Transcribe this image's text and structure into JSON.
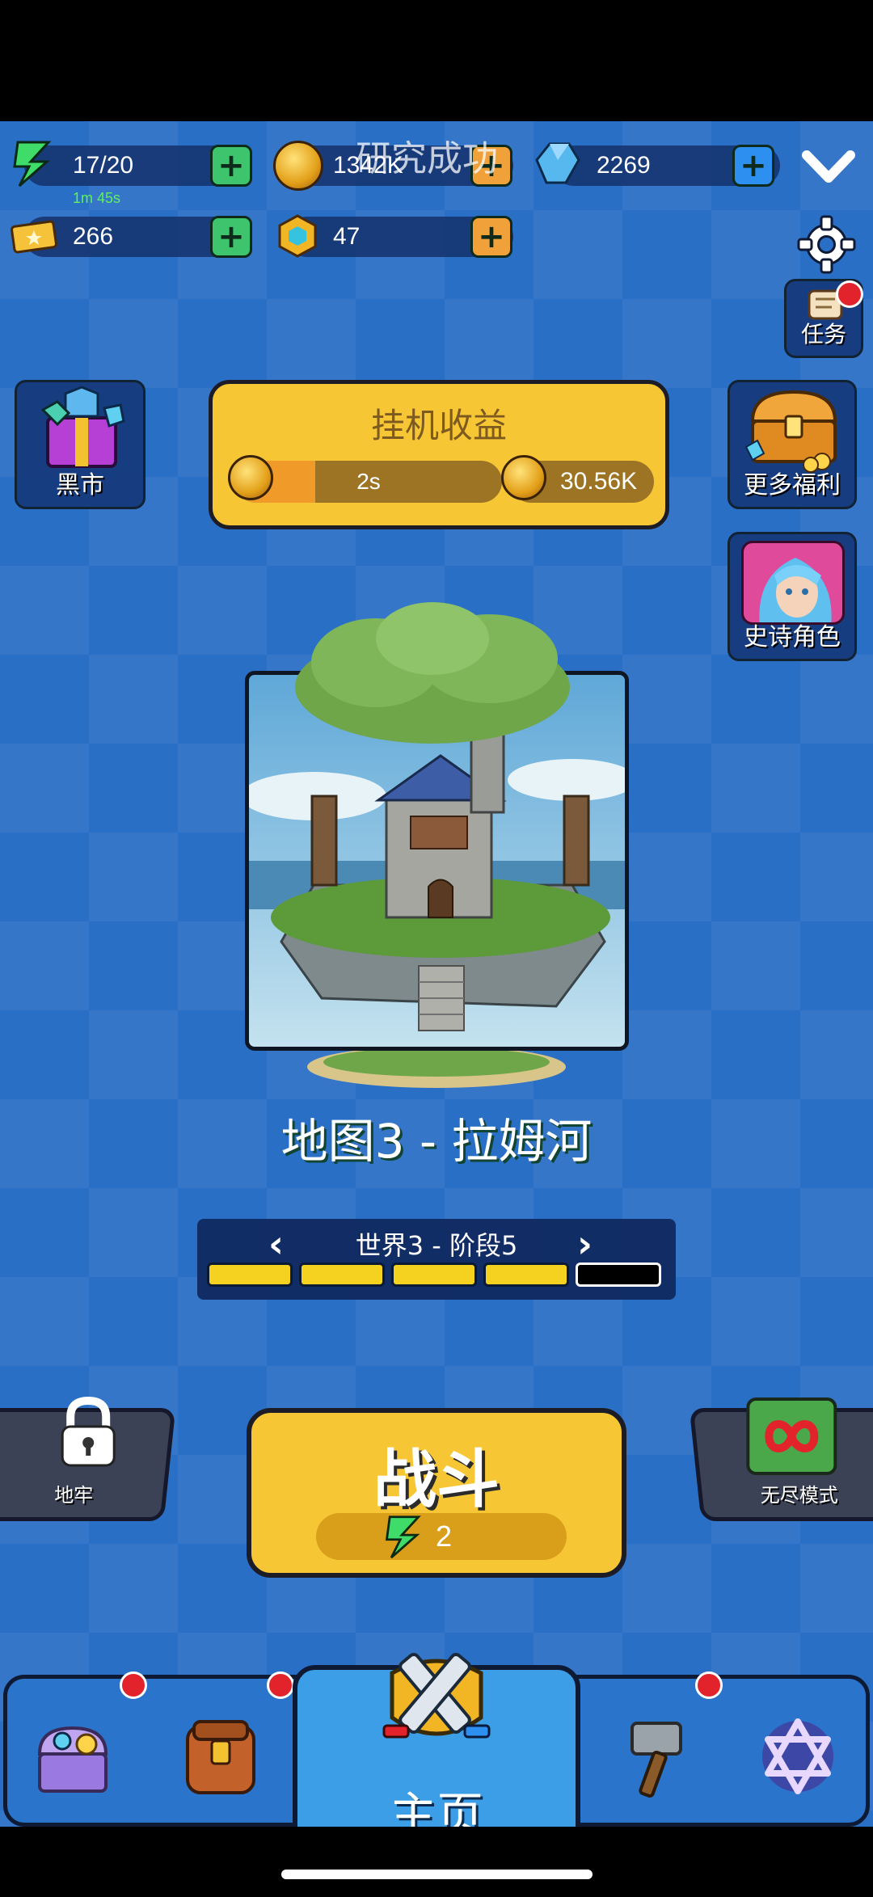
{
  "resources": {
    "energy": {
      "value": "17/20",
      "timer": "1m 45s"
    },
    "gold": {
      "value": "1342K"
    },
    "gems": {
      "value": "2269"
    },
    "tickets": {
      "value": "266"
    },
    "hexgems": {
      "value": "47"
    }
  },
  "toast": "研究成功",
  "side_buttons": {
    "black_market": "黑市",
    "tasks": "任务",
    "more_benefits": "更多福利",
    "epic_hero": "史诗角色"
  },
  "idle_income": {
    "title": "挂机收益",
    "timer": "2s",
    "progress": 0.3,
    "amount": "30.56K"
  },
  "map": {
    "title": "地图3 - 拉姆河"
  },
  "stage": {
    "label": "世界3 - 阶段5",
    "segments_total": 5,
    "segments_filled": 4
  },
  "battle": {
    "label": "战斗",
    "cost": "2"
  },
  "modes": {
    "dungeon": "地牢",
    "endless": "无尽模式"
  },
  "nav": {
    "home": "主页"
  },
  "icons": {
    "energy": "lightning-icon",
    "gold": "coin-icon",
    "gem": "gem-icon",
    "ticket": "ticket-icon",
    "hexgem": "hexgem-icon",
    "settings": "gear-icon",
    "collapse": "chevron-down-icon",
    "lock": "lock-icon",
    "infinity": "infinity-icon",
    "swords": "crossed-swords-icon",
    "hammer": "hammer-icon",
    "star": "hexagram-icon",
    "chest": "treasure-chest-icon",
    "backpack": "backpack-icon"
  },
  "colors": {
    "accent_yellow": "#f7c635",
    "background_blue": "#2a6fc6",
    "notification_red": "#e2232b",
    "plus_green": "#3ec46d",
    "plus_orange": "#f0a13a",
    "plus_blue": "#2d8ff0"
  }
}
